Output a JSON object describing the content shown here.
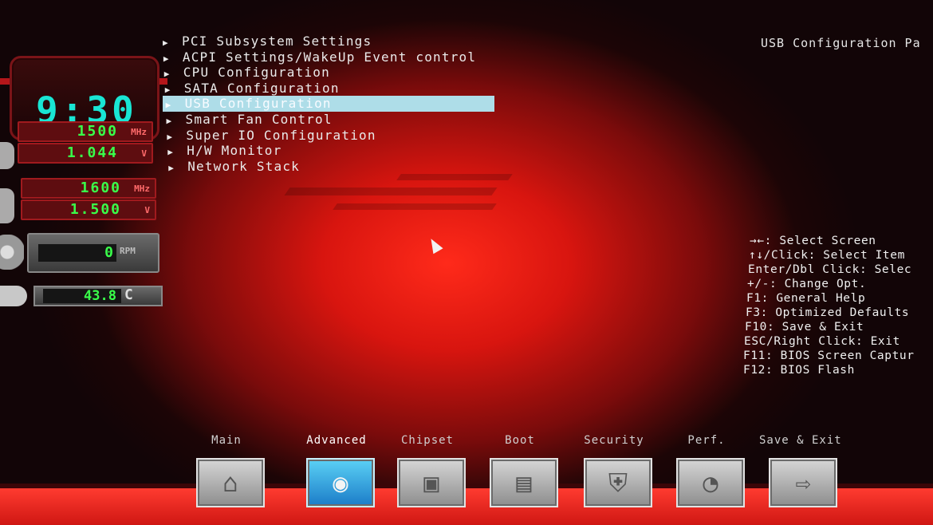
{
  "monitor": {
    "clock": "9:30",
    "cpu_freq": "1500",
    "cpu_freq_unit": "MHz",
    "cpu_voltage": "1.044",
    "cpu_voltage_unit": "V",
    "mem_freq": "1600",
    "mem_freq_unit": "MHz",
    "mem_voltage": "1.500",
    "mem_voltage_unit": "V",
    "fan_speed": "0",
    "fan_unit": "RPM",
    "temperature": "43.8",
    "temp_unit": "C"
  },
  "menu": {
    "items": [
      {
        "label": "PCI Subsystem Settings"
      },
      {
        "label": "ACPI Settings/WakeUp Event control"
      },
      {
        "label": "CPU Configuration"
      },
      {
        "label": "SATA Configuration"
      },
      {
        "label": "USB Configuration",
        "selected": true
      },
      {
        "label": "Smart Fan Control"
      },
      {
        "label": "Super IO Configuration"
      },
      {
        "label": "H/W Monitor"
      },
      {
        "label": "Network Stack"
      }
    ]
  },
  "help": {
    "title": "USB Configuration Pa",
    "lines": [
      "→←: Select Screen",
      "↑↓/Click: Select Item",
      "Enter/Dbl Click: Selec",
      "+/-: Change Opt.",
      "F1: General Help",
      "F3: Optimized Defaults",
      "F10: Save & Exit",
      "ESC/Right Click: Exit",
      "F11: BIOS Screen Captur",
      "F12: BIOS Flash"
    ]
  },
  "tabs": [
    {
      "label": "Main",
      "icon": "home-icon",
      "glyph": "⌂",
      "active": false
    },
    {
      "label": "Advanced",
      "icon": "advanced-icon",
      "glyph": "◉",
      "active": true
    },
    {
      "label": "Chipset",
      "icon": "chipset-icon",
      "glyph": "▣",
      "active": false
    },
    {
      "label": "Boot",
      "icon": "boot-drive-icon",
      "glyph": "▤",
      "active": false
    },
    {
      "label": "Security",
      "icon": "security-shield-icon",
      "glyph": "⛨",
      "active": false
    },
    {
      "label": "Perf.",
      "icon": "performance-icon",
      "glyph": "◔",
      "active": false
    },
    {
      "label": "Save & Exit",
      "icon": "save-exit-icon",
      "glyph": "⇨",
      "active": false
    }
  ],
  "colors": {
    "accent_selected": "#aedde8",
    "digit_green": "#39ff4a",
    "clock_cyan": "#19e6d4"
  }
}
